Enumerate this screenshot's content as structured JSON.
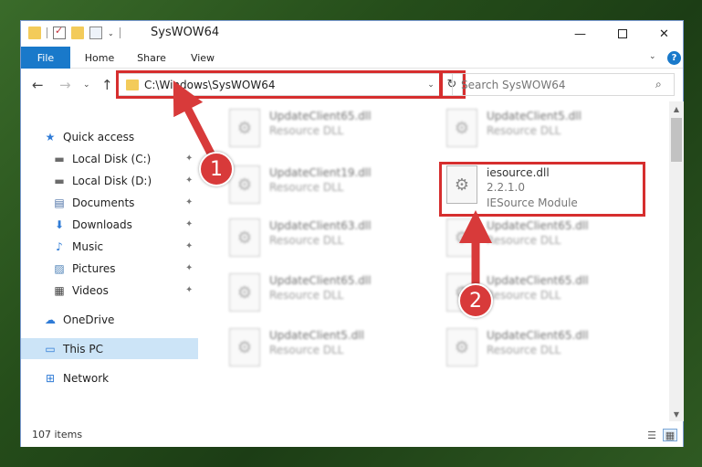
{
  "window": {
    "title": "SysWOW64",
    "minimize": "—",
    "close": "✕"
  },
  "ribbon": {
    "tabs": [
      "File",
      "Home",
      "Share",
      "View"
    ],
    "chevron": "⌄",
    "help": "?"
  },
  "nav": {
    "back": "←",
    "forward": "→",
    "recent": "⌄",
    "up": "↑",
    "address": "C:\\Windows\\SysWOW64",
    "address_dropdown": "⌄",
    "refresh": "↻",
    "search_placeholder": "Search SysWOW64",
    "search_icon": "⌕"
  },
  "sidebar": {
    "items": [
      {
        "label": "Quick access",
        "icon": "star-icon",
        "glyph": "★",
        "color": "#2f7bd6",
        "pinned": false
      },
      {
        "label": "Local Disk (C:)",
        "icon": "drive-icon",
        "glyph": "▬",
        "color": "#6b6b6b",
        "pinned": true
      },
      {
        "label": "Local Disk (D:)",
        "icon": "drive-icon",
        "glyph": "▬",
        "color": "#6b6b6b",
        "pinned": true
      },
      {
        "label": "Documents",
        "icon": "documents-icon",
        "glyph": "▤",
        "color": "#4a6fa5",
        "pinned": true
      },
      {
        "label": "Downloads",
        "icon": "download-icon",
        "glyph": "⬇",
        "color": "#2f7bd6",
        "pinned": true
      },
      {
        "label": "Music",
        "icon": "music-icon",
        "glyph": "♪",
        "color": "#2f7bd6",
        "pinned": true
      },
      {
        "label": "Pictures",
        "icon": "pictures-icon",
        "glyph": "▨",
        "color": "#4a7fb5",
        "pinned": true
      },
      {
        "label": "Videos",
        "icon": "videos-icon",
        "glyph": "▦",
        "color": "#444444",
        "pinned": true
      },
      {
        "label": "OneDrive",
        "icon": "cloud-icon",
        "glyph": "☁",
        "color": "#2f7bd6",
        "pinned": false
      },
      {
        "label": "This PC",
        "icon": "computer-icon",
        "glyph": "▭",
        "color": "#2f7bd6",
        "pinned": false
      },
      {
        "label": "Network",
        "icon": "network-icon",
        "glyph": "⊞",
        "color": "#2f7bd6",
        "pinned": false
      }
    ],
    "pin_glyph": "✦"
  },
  "files": [
    {
      "name": "UpdateClient65.dll",
      "desc": "Resource DLL",
      "blurred": true
    },
    {
      "name": "UpdateClient5.dll",
      "desc": "Resource DLL",
      "blurred": true
    },
    {
      "name": "UpdateClient19.dll",
      "desc": "Resource DLL",
      "blurred": true
    },
    {
      "name": "iesource.dll",
      "version": "2.2.1.0",
      "desc": "IESource Module",
      "blurred": false
    },
    {
      "name": "UpdateClient63.dll",
      "desc": "Resource DLL",
      "blurred": true
    },
    {
      "name": "UpdateClient65.dll",
      "desc": "Resource DLL",
      "blurred": true
    },
    {
      "name": "UpdateClient65.dll",
      "desc": "Resource DLL",
      "blurred": true
    },
    {
      "name": "UpdateClient65.dll",
      "desc": "Resource DLL",
      "blurred": true
    },
    {
      "name": "UpdateClient5.dll",
      "desc": "Resource DLL",
      "blurred": true
    },
    {
      "name": "UpdateClient65.dll",
      "desc": "Resource DLL",
      "blurred": true
    }
  ],
  "file_icon_glyph": "⚙",
  "scrollbar": {
    "up": "▲",
    "down": "▼"
  },
  "status": {
    "count": "107 items",
    "details_icon": "☰",
    "tiles_icon": "▦"
  },
  "callouts": {
    "step1": "1",
    "step2": "2",
    "color": "#d83a3a"
  }
}
